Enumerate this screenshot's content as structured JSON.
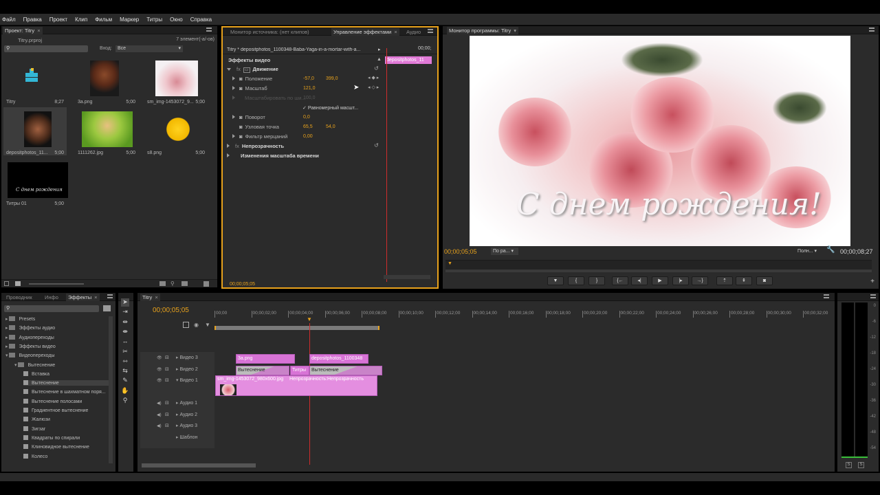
{
  "menu": [
    "Файл",
    "Правка",
    "Проект",
    "Клип",
    "Фильм",
    "Маркер",
    "Титры",
    "Окно",
    "Справка"
  ],
  "project": {
    "tab": "Проект: Titry",
    "file": "Titry.prproj",
    "count": "7 элемент(-а/-ов)",
    "in_label": "Вход:",
    "in_value": "Все",
    "items": [
      {
        "name": "Titry",
        "dur": "8;27"
      },
      {
        "name": "3a.png",
        "dur": "5;00"
      },
      {
        "name": "sm_img-1453072_9...",
        "dur": "5;00"
      },
      {
        "name": "depositphotos_11...",
        "dur": "5;00"
      },
      {
        "name": "1111262.jpg",
        "dur": "5;00"
      },
      {
        "name": "s8.png",
        "dur": "5;00"
      },
      {
        "name": "Титры 01",
        "dur": "5;00"
      }
    ],
    "thumb_text": "С днем рождения"
  },
  "effect_controls": {
    "tab_source": "Монитор источника: (нет клипов)",
    "tab_active": "Управление эффектами",
    "tab_audio": "Аудио",
    "header": "Titry * depositphotos_1100348-Baba-Yaga-in-a-mortar-with-a...",
    "clip_time": "00;00;",
    "clip_label": "depositphotos_11",
    "section_video": "Эффекты видео",
    "motion": "Движение",
    "position": "Положение",
    "pos_x": "-57,0",
    "pos_y": "399,0",
    "scale": "Масштаб",
    "scale_val": "121,0",
    "scale_width": "Масштабировать по ши...",
    "scale_width_val": "100,0",
    "uniform": "Равномерный масшт...",
    "rotation": "Поворот",
    "rotation_val": "0,0",
    "anchor": "Узловая точка",
    "anchor_x": "65,5",
    "anchor_y": "54,0",
    "flicker": "Фильтр мерцаний",
    "flicker_val": "0,00",
    "opacity": "Непрозрачность",
    "time_remap": "Изменения масштаба времени",
    "timecode": "00;00;05;05"
  },
  "program": {
    "tab": "Монитор программы: Titry",
    "timecode": "00;00;05;05",
    "fit": "По ра...",
    "quality": "Полн...",
    "duration": "00;00;08;27",
    "overlay_text": "С днем рождения!"
  },
  "effects_panel": {
    "tab1": "Проводник",
    "tab2": "Инфо",
    "tab3": "Эффекты",
    "items": [
      {
        "label": "Presets",
        "type": "folder",
        "indent": 0
      },
      {
        "label": "Эффекты аудио",
        "type": "folder",
        "indent": 0
      },
      {
        "label": "Аудиопереходы",
        "type": "folder",
        "indent": 0
      },
      {
        "label": "Эффекты видео",
        "type": "folder",
        "indent": 0
      },
      {
        "label": "Видеопереходы",
        "type": "folder",
        "indent": 0
      },
      {
        "label": "Вытеснение",
        "type": "folder",
        "indent": 1
      },
      {
        "label": "Вставка",
        "type": "item",
        "indent": 2
      },
      {
        "label": "Вытеснение",
        "type": "item",
        "indent": 2
      },
      {
        "label": "Вытеснение в шахматном поря...",
        "type": "item",
        "indent": 2
      },
      {
        "label": "Вытеснение полосами",
        "type": "item",
        "indent": 2
      },
      {
        "label": "Градиентное вытеснение",
        "type": "item",
        "indent": 2
      },
      {
        "label": "Жалюзи",
        "type": "item",
        "indent": 2
      },
      {
        "label": "Зигзаг",
        "type": "item",
        "indent": 2
      },
      {
        "label": "Квадраты по спирали",
        "type": "item",
        "indent": 2
      },
      {
        "label": "Клиновидное вытеснение",
        "type": "item",
        "indent": 2
      },
      {
        "label": "Колесо",
        "type": "item",
        "indent": 2
      }
    ]
  },
  "timeline": {
    "tab": "Titry",
    "timecode": "00;00;05;05",
    "ruler": [
      "00;00",
      "00;00;02;00",
      "00;00;04;00",
      "00;00;06;00",
      "00;00;08;00",
      "00;00;10;00",
      "00;00;12;00",
      "00;00;14;00",
      "00;00;16;00",
      "00;00;18;00",
      "00;00;20;00",
      "00;00;22;00",
      "00;00;24;00",
      "00;00;26;00",
      "00;00;28;00",
      "00;00;30;00",
      "00;00;32;00"
    ],
    "tracks": [
      "Видео 3",
      "Видео 2",
      "Видео 1",
      "Аудио 1",
      "Аудио 2",
      "Аудио 3",
      "Шаблон"
    ],
    "clips": {
      "v3a": "3a.png",
      "v3b": "depositphotos_1100348",
      "v2a": "Вытеснение",
      "v2b": "Титры",
      "v2c": "Вытеснение",
      "v1a": "sm_img-1453072_980x600.jpg",
      "v1b": "Непрозрачность:Непрозрачность"
    }
  },
  "vu": [
    "0",
    "-6",
    "-12",
    "-18",
    "-24",
    "-30",
    "-36",
    "-42",
    "-48",
    "-54"
  ]
}
